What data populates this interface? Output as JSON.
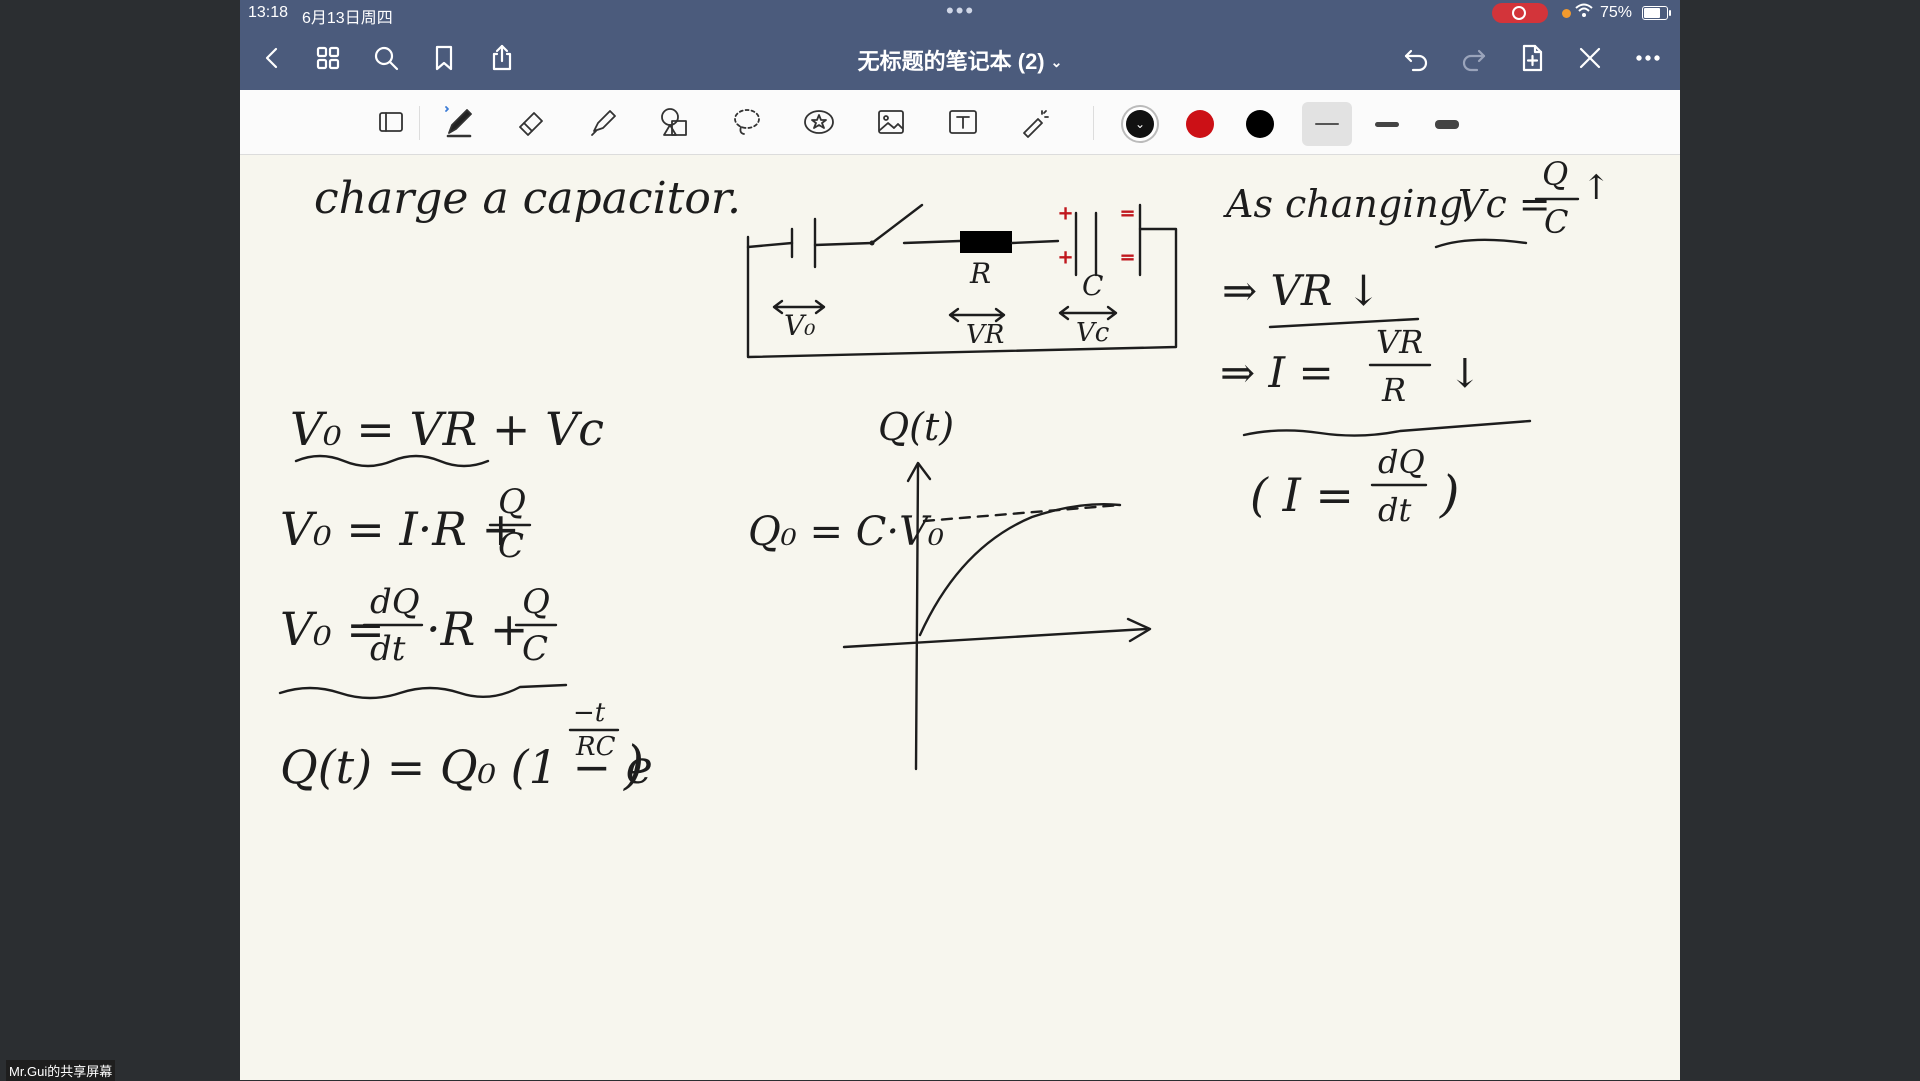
{
  "status": {
    "time": "13:18",
    "date": "6月13日周四",
    "battery": "75%"
  },
  "nav": {
    "title": "无标题的笔记本 (2)"
  },
  "toolbar": {
    "colors": [
      "#111111",
      "#cc1016",
      "#000000"
    ],
    "icons": [
      "page-layout-icon",
      "pen-icon",
      "eraser-icon",
      "highlighter-icon",
      "shapes-icon",
      "lasso-icon",
      "sticker-icon",
      "image-icon",
      "text-icon",
      "laser-pointer-icon"
    ]
  },
  "note": {
    "heading": "charge a capacitor.",
    "labels": {
      "v0": "V₀",
      "r": "R",
      "vr": "VR",
      "c": "C",
      "vc": "Vc"
    },
    "eq1": "V₀ = VR + Vc",
    "eq2_lhs": "V₀ = I·R +",
    "eq3_lhs": "V₀ =",
    "eq3_mid": "·R +",
    "eq4": "Q(t) = Q₀ (1 − e",
    "eq4_exp_num": "−t",
    "eq4_exp_den": "RC",
    "eq4_close": ")",
    "frac_q": "Q",
    "frac_c": "C",
    "frac_dq": "dQ",
    "frac_dt": "dt",
    "graph_ylabel": "Q(t)",
    "graph_q0": "Q₀ = C·V₀",
    "right1_a": "As changing,",
    "right1_b": "Vc =",
    "right1_arrow": "↑",
    "right2": "⇒ VR ↓",
    "right3_a": "⇒ I =",
    "right3_num": "VR",
    "right3_den": "R",
    "right3_arrow": "↓",
    "right4_a": "( I =",
    "right4_num": "dQ",
    "right4_den": "dt",
    "right4_close": ")"
  },
  "share_label": "Mr.Gui的共享屏幕"
}
